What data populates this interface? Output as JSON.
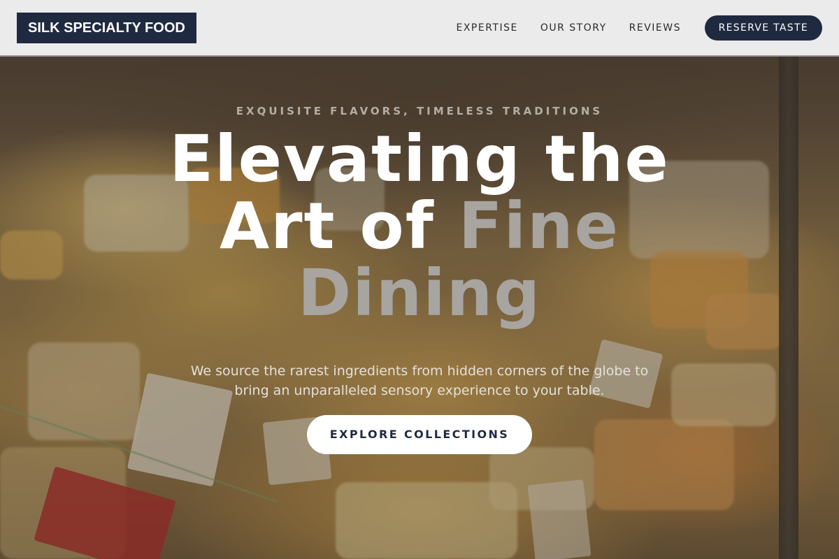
{
  "nav": {
    "brand": "SILK SPECIALTY FOOD",
    "links": [
      "EXPERTISE",
      "OUR STORY",
      "REVIEWS"
    ],
    "cta_label": "RESERVE TASTE"
  },
  "hero": {
    "eyebrow": "EXQUISITE FLAVORS, TIMELESS TRADITIONS",
    "headline_line1": "Elevating the",
    "headline_line2_white": "Art of ",
    "headline_accent_1": "Fine",
    "headline_accent_2": "Dining",
    "subtitle": "We source the rarest ingredients from hidden corners of the globe to bring an unparalleled sensory experience to your table.",
    "button_label": "EXPLORE COLLECTIONS",
    "background_description": "cheese-counter-photo"
  },
  "colors": {
    "brand_navy": "#1f2a40",
    "navbar_bg": "#ebebeb",
    "accent_text": "#a8a4a0",
    "button_bg": "#ffffff"
  }
}
